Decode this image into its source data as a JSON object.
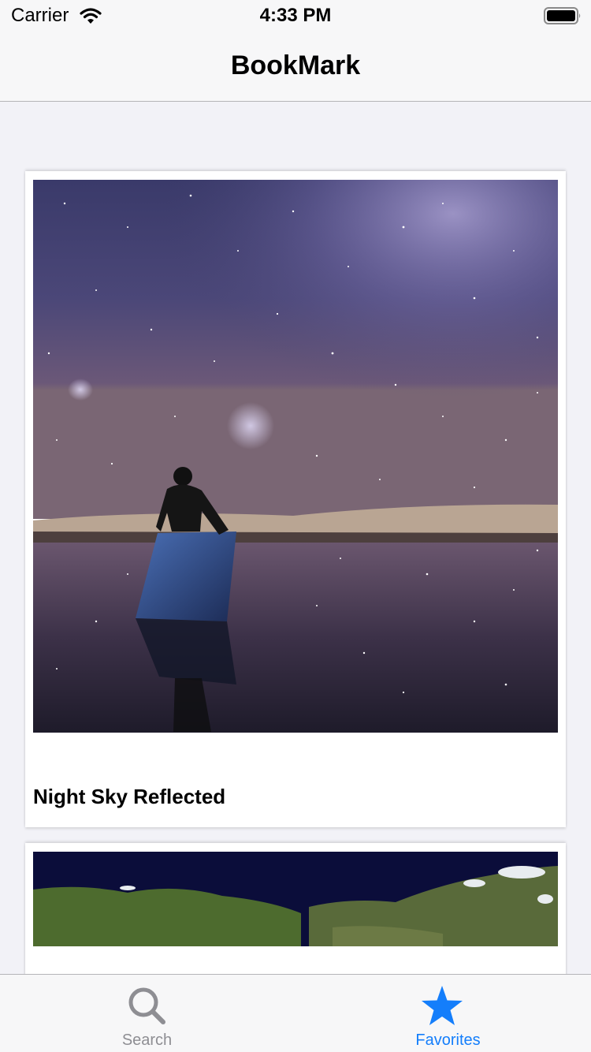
{
  "status_bar": {
    "carrier": "Carrier",
    "time": "4:33 PM",
    "wifi_icon": "wifi-icon",
    "battery_icon": "battery-full-icon"
  },
  "nav_bar": {
    "title": "BookMark"
  },
  "favorites": [
    {
      "title": "Night Sky Reflected",
      "image": "night-sky-mirror-photo"
    },
    {
      "title": "",
      "image": "earth-satellite-photo"
    }
  ],
  "tab_bar": {
    "tabs": [
      {
        "label": "Search",
        "icon": "search-icon",
        "selected": false
      },
      {
        "label": "Favorites",
        "icon": "star-icon",
        "selected": true
      }
    ]
  },
  "colors": {
    "accent": "#147efb",
    "inactive_tab": "#8e8e93",
    "background": "#f2f2f7",
    "bar_background": "#f7f7f8"
  }
}
